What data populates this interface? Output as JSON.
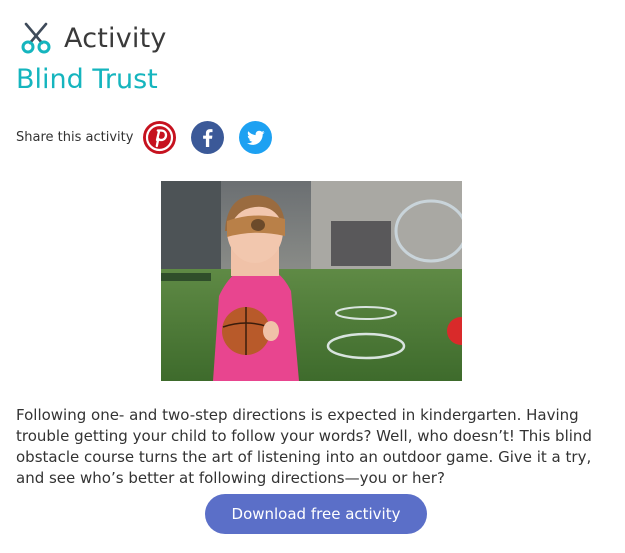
{
  "header": {
    "icon": "scissors-icon",
    "label": "Activity"
  },
  "activity": {
    "title": "Blind Trust",
    "description": "Following one- and two-step directions is expected in kindergarten. Having trouble getting your child to follow your words? Well, who doesn’t! This blind obstacle course turns the art of listening into an outdoor game. Give it a try, and see who’s better at following directions—you or her?"
  },
  "share": {
    "label": "Share this activity",
    "icons": [
      "pinterest-icon",
      "facebook-icon",
      "twitter-icon"
    ]
  },
  "cta": {
    "label": "Download free activity"
  },
  "colors": {
    "title": "#15b5be",
    "button": "#5b6fc8",
    "pinterest": "#c6121f",
    "facebook": "#3b5998",
    "twitter": "#1da1f2"
  }
}
